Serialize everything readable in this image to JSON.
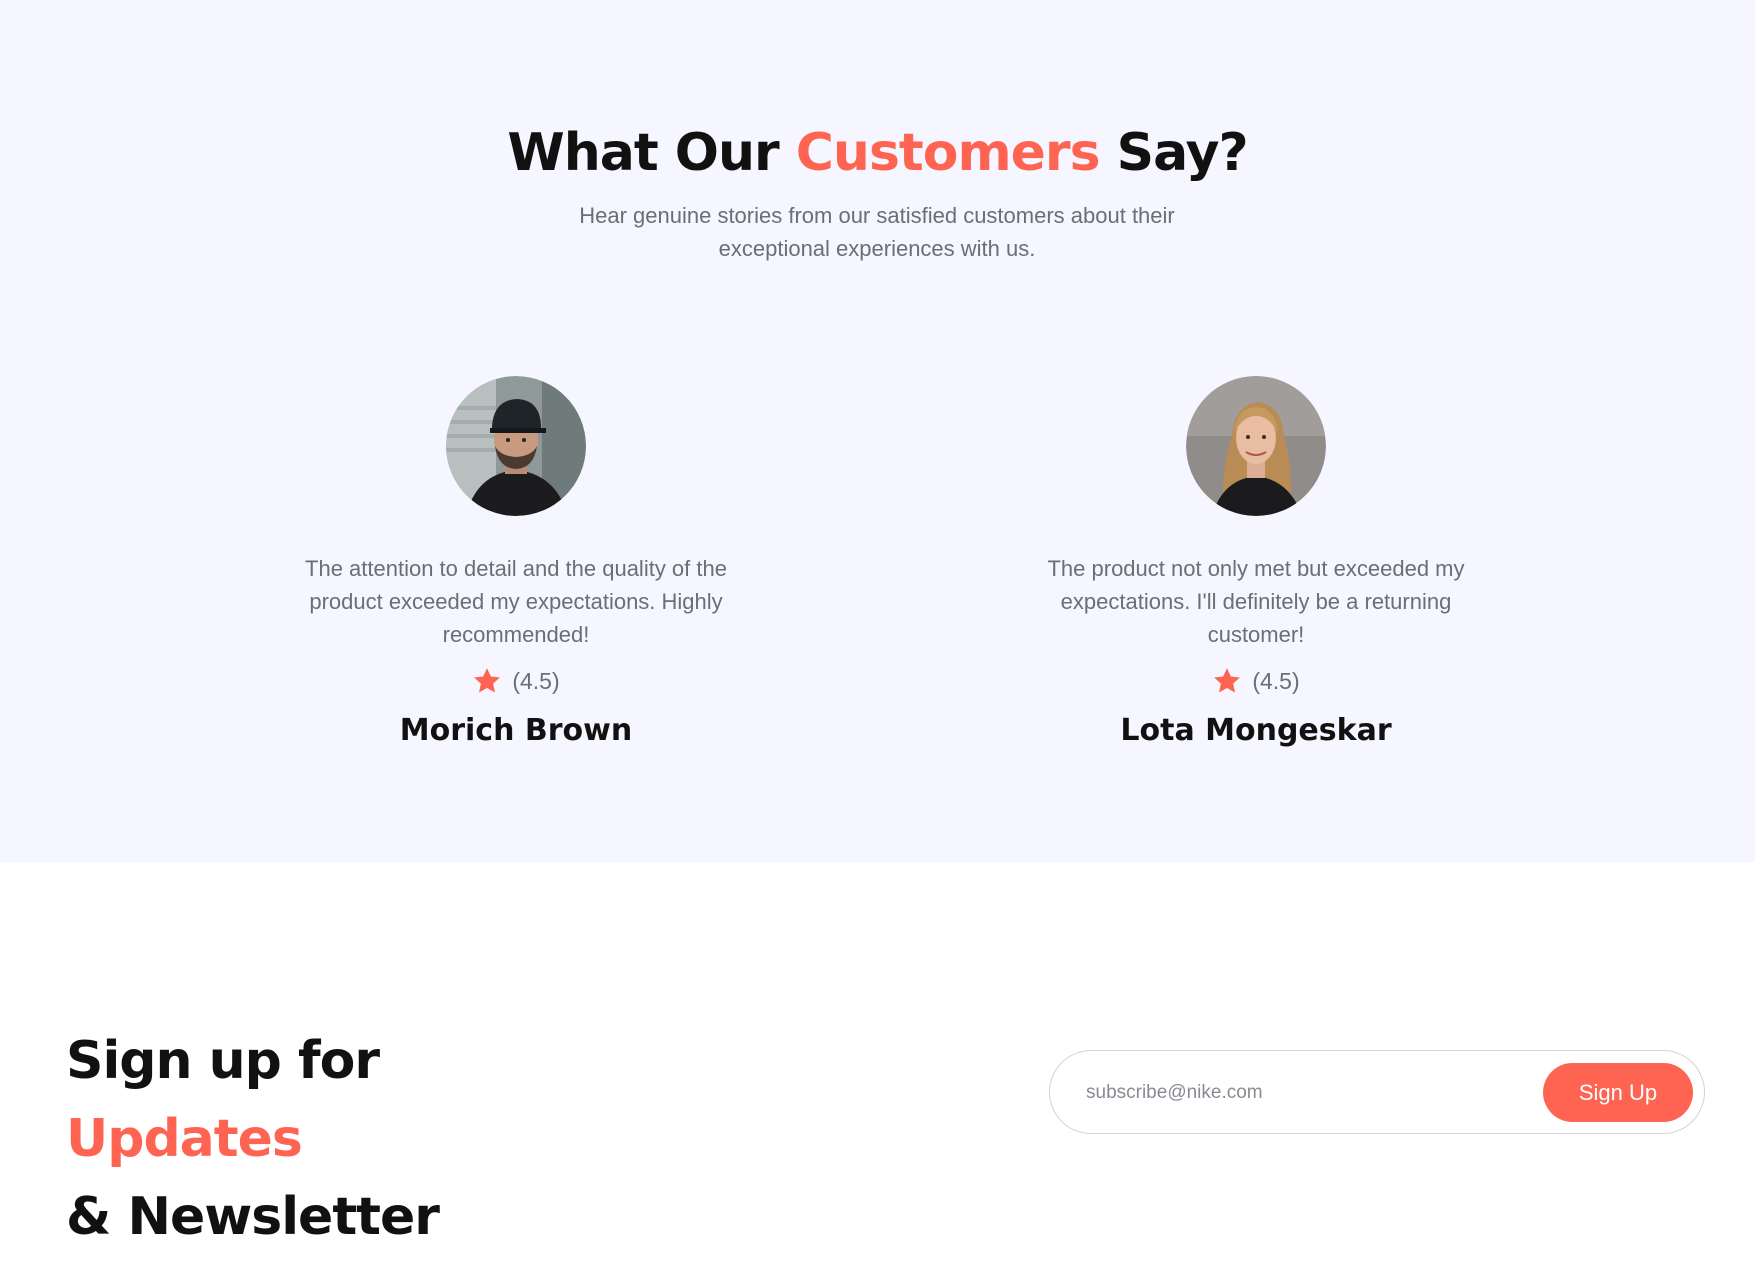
{
  "colors": {
    "accent": "#ff6452",
    "section_bg": "#f5f6ff",
    "muted_text": "#6d6d74",
    "heading_text": "#111111"
  },
  "testimonials": {
    "heading_prefix": "What Our ",
    "heading_accent": "Customers",
    "heading_suffix": " Say?",
    "subtitle": "Hear genuine stories from our satisfied customers about their exceptional experiences with us.",
    "reviews": [
      {
        "quote": "The attention to detail and the quality of the product exceeded my expectations. Highly recommended!",
        "rating_text": "(4.5)",
        "rating_icon": "star-icon",
        "name": "Morich Brown",
        "avatar": "man-in-cap-avatar"
      },
      {
        "quote": "The product not only met but exceeded my expectations. I'll definitely be a returning customer!",
        "rating_text": "(4.5)",
        "rating_icon": "star-icon",
        "name": "Lota Mongeskar",
        "avatar": "woman-blonde-avatar"
      }
    ]
  },
  "newsletter": {
    "title_prefix": "Sign up for ",
    "title_accent": "Updates",
    "title_line2": "& Newsletter",
    "email_placeholder": "subscribe@nike.com",
    "button_label": "Sign Up"
  }
}
